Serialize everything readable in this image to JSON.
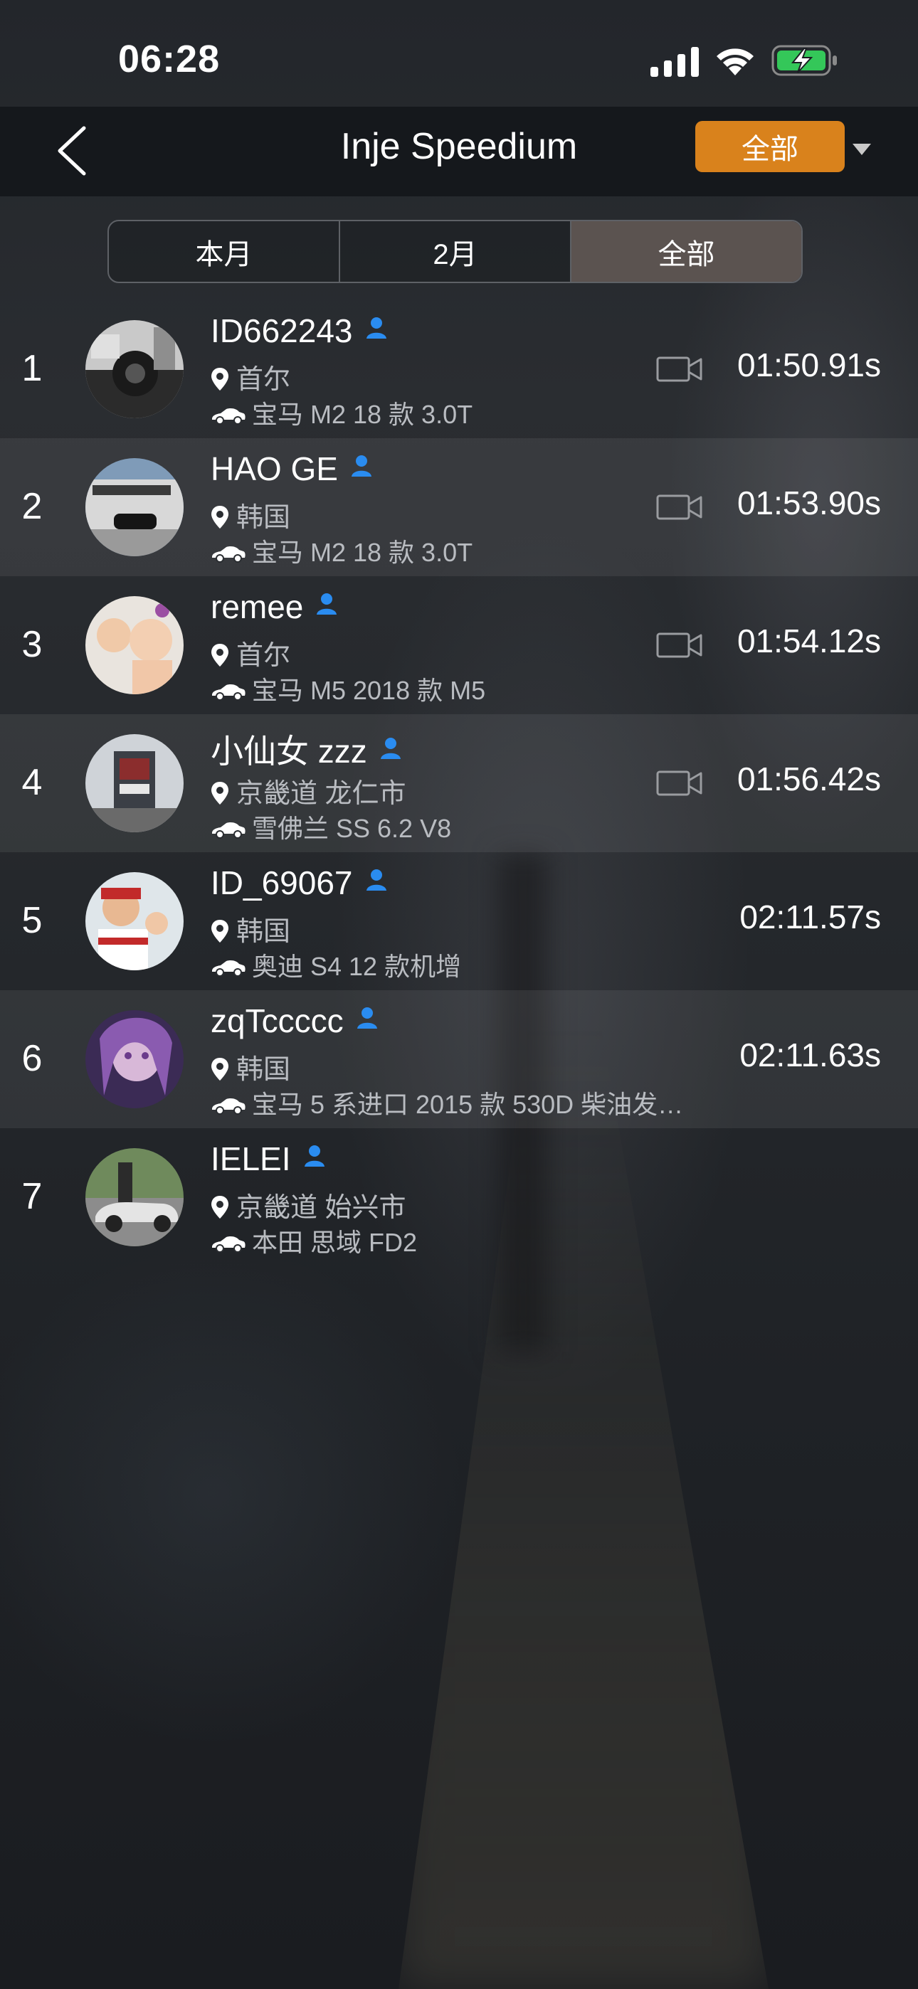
{
  "status_bar": {
    "time": "06:28"
  },
  "nav": {
    "title": "Inje Speedium",
    "filter_label": "全部"
  },
  "tabs": [
    {
      "label": "本月",
      "active": false
    },
    {
      "label": "2月",
      "active": false
    },
    {
      "label": "全部",
      "active": true
    }
  ],
  "leaderboard": [
    {
      "rank": "1",
      "name": "ID662243",
      "location": "首尔",
      "car": "宝马 M2 18 款 3.0T",
      "has_video": true,
      "time": "01:50.91s"
    },
    {
      "rank": "2",
      "name": "HAO GE",
      "location": "韩国",
      "car": "宝马 M2 18 款 3.0T",
      "has_video": true,
      "time": "01:53.90s"
    },
    {
      "rank": "3",
      "name": "remee",
      "location": "首尔",
      "car": "宝马 M5 2018 款 M5",
      "has_video": true,
      "time": "01:54.12s"
    },
    {
      "rank": "4",
      "name": "小仙女 zzz",
      "location": "京畿道 龙仁市",
      "car": "雪佛兰 SS 6.2 V8",
      "has_video": true,
      "time": "01:56.42s"
    },
    {
      "rank": "5",
      "name": "ID_69067",
      "location": "韩国",
      "car": "奥迪 S4 12 款机增",
      "has_video": false,
      "time": "02:11.57s"
    },
    {
      "rank": "6",
      "name": "zqTccccc",
      "location": "韩国",
      "car": "宝马 5 系进口 2015 款 530D 柴油发…",
      "has_video": false,
      "time": "02:11.63s"
    },
    {
      "rank": "7",
      "name": "IELEI",
      "location": "京畿道 始兴市",
      "car": "本田 思域 FD2",
      "has_video": false,
      "time": ""
    }
  ],
  "colors": {
    "accent": "#d9821c",
    "user_icon": "#2a8cf0",
    "active_tab": "#5b5350"
  }
}
